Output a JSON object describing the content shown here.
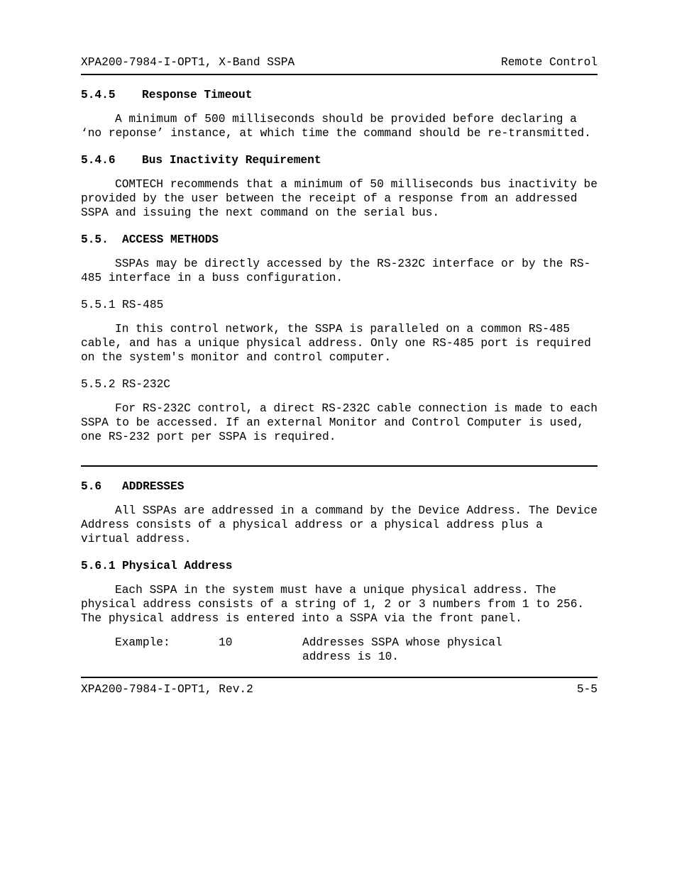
{
  "header": {
    "left": "XPA200-7984-I-OPT1, X-Band SSPA",
    "right": "Remote Control"
  },
  "sec545": {
    "num": "5.4.5",
    "title": "Response Timeout",
    "para": "A minimum of 500 milliseconds should be provided before declaring a ‘no reponse’ instance, at which time the command should be re-transmitted."
  },
  "sec546": {
    "num": "5.4.6",
    "title": "Bus Inactivity Requirement",
    "para": "COMTECH recommends that a minimum of 50 milliseconds bus inactivity be provided by the user between the receipt of a response from an addressed SSPA and issuing the next command on the serial bus."
  },
  "sec55": {
    "num": "5.5.",
    "title": "ACCESS METHODS",
    "para": "SSPAs may be directly accessed by the RS-232C interface or by the RS-485 interface in a buss configuration."
  },
  "sec551": {
    "num": "5.5.1",
    "title": "RS-485",
    "para": "In this control network, the SSPA is paralleled on a common RS-485 cable, and has a unique physical address.  Only one RS-485 port is required on the system's monitor and control computer."
  },
  "sec552": {
    "num": "5.5.2",
    "title": "RS-232C",
    "para": "For RS-232C control, a direct RS-232C cable connection is made to each SSPA to be accessed.  If an external Monitor and Control Computer is used, one RS-232 port per SSPA is required."
  },
  "sec56": {
    "num": "5.6",
    "title": "ADDRESSES",
    "para": "All SSPAs are addressed in a command by the Device Address.  The Device Address consists of a physical address or a physical address plus a virtual address."
  },
  "sec561": {
    "num": "5.6.1",
    "title": "Physical Address",
    "para": "Each SSPA in the system must have a unique physical address.  The physical address consists of a  string of 1, 2 or 3 numbers from 1 to 256.  The physical address is entered into a SSPA via the front panel.",
    "example": {
      "label": "Example:",
      "value": "10",
      "desc1": "Addresses SSPA whose physical",
      "desc2": "address is 10."
    }
  },
  "footer": {
    "left": "XPA200-7984-I-OPT1, Rev.2",
    "right": "5-5"
  }
}
